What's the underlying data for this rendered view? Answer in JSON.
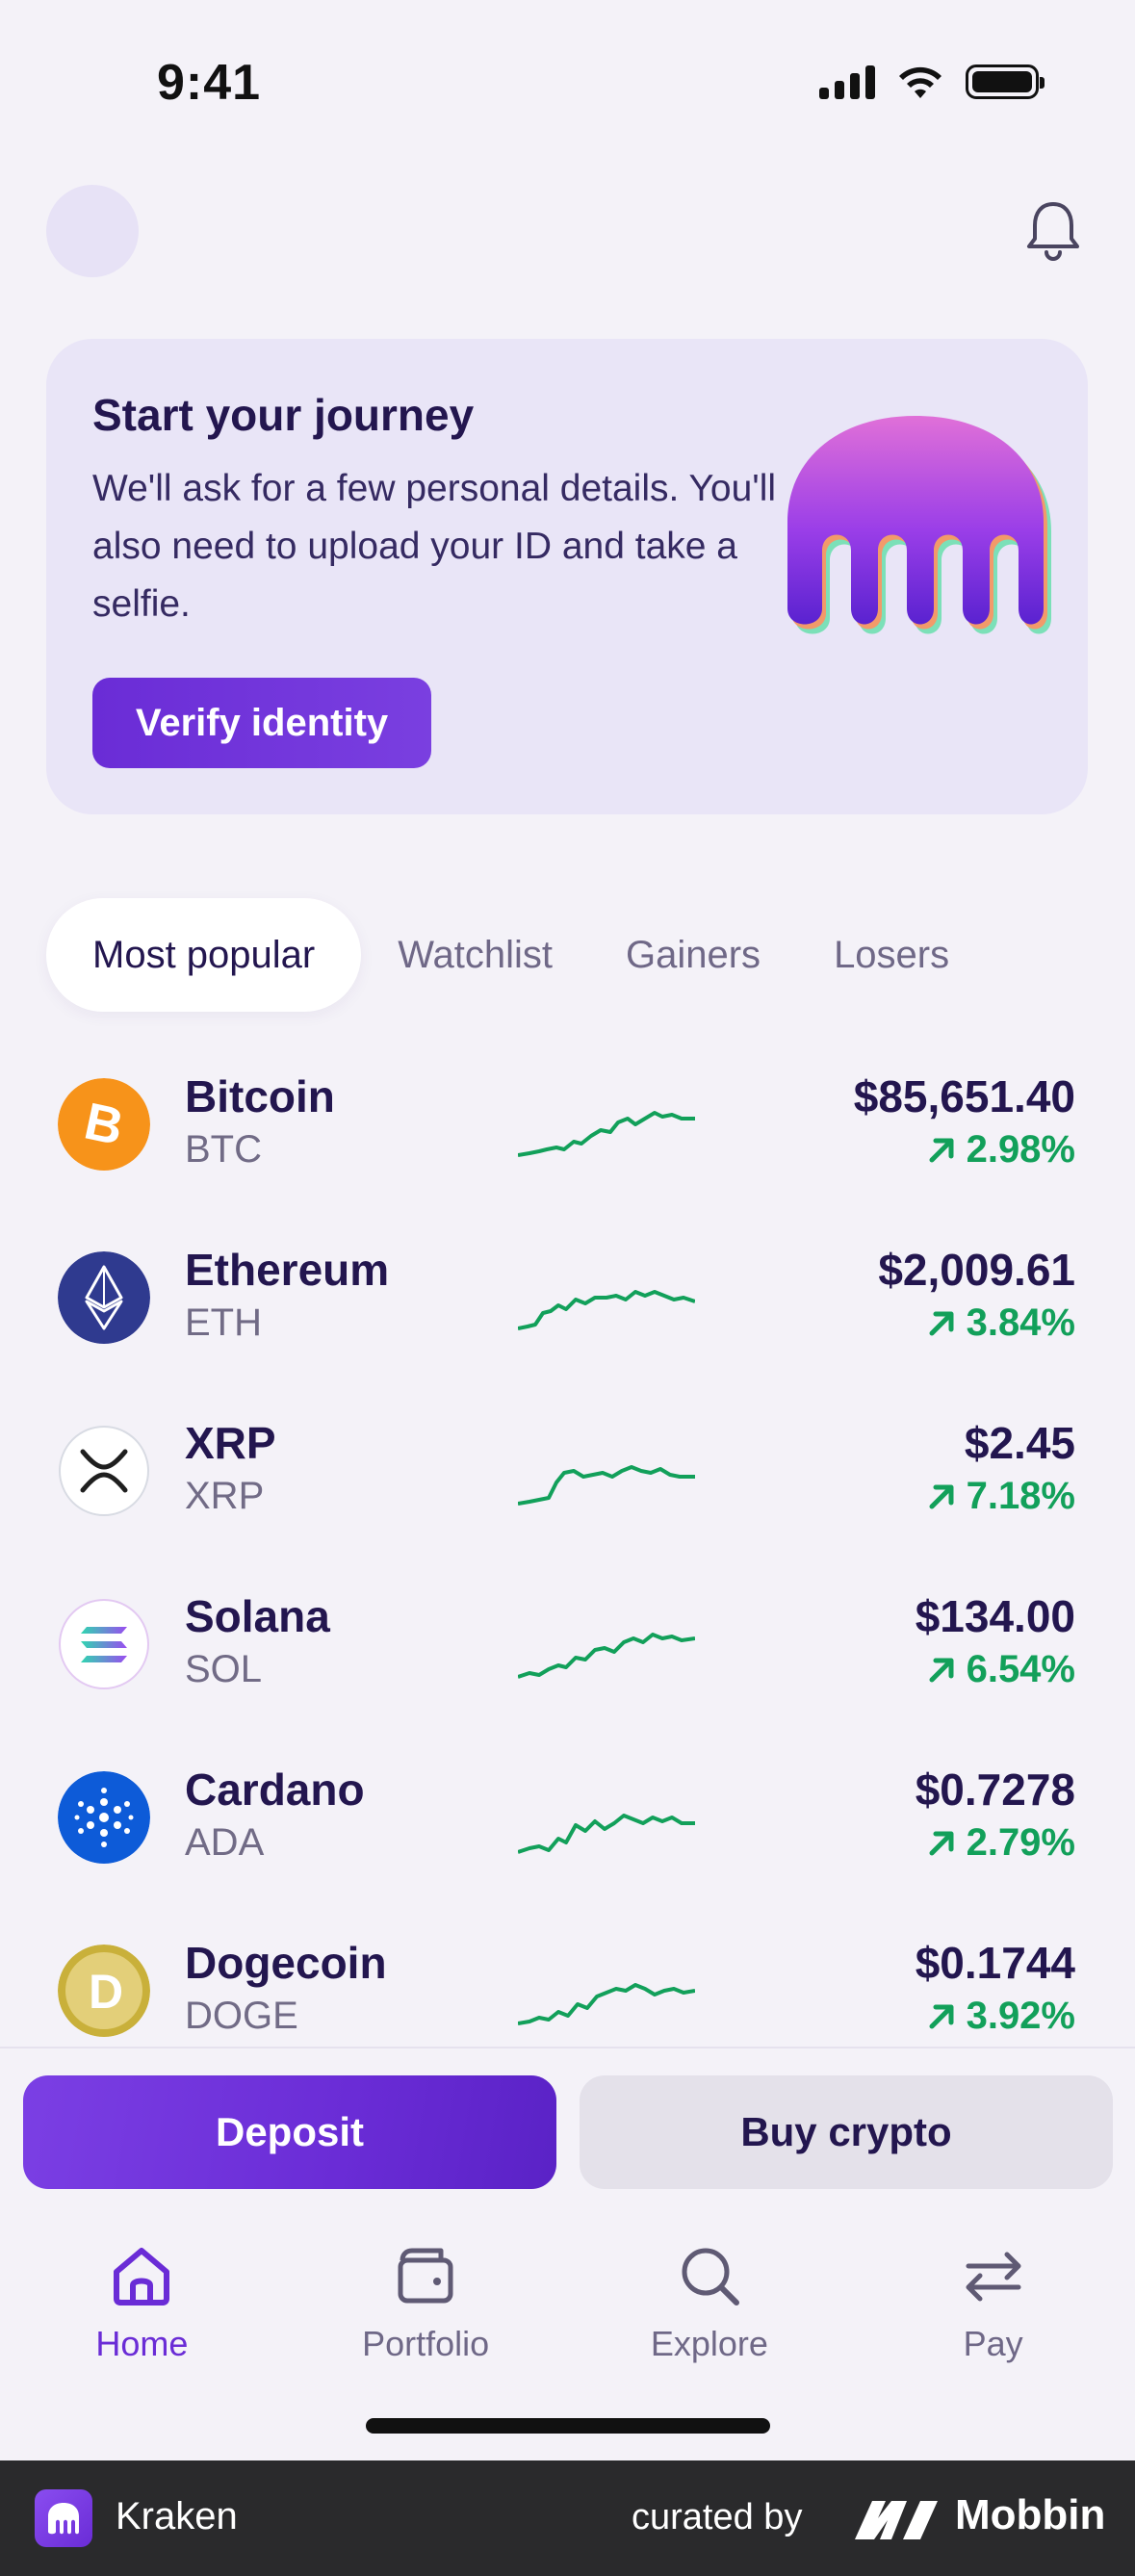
{
  "status": {
    "time": "9:41"
  },
  "journey_card": {
    "title": "Start your journey",
    "body": "We'll ask for a few personal details. You'll also need to upload your ID and take a selfie.",
    "button_label": "Verify identity"
  },
  "tabs": [
    {
      "label": "Most popular",
      "active": true
    },
    {
      "label": "Watchlist",
      "active": false
    },
    {
      "label": "Gainers",
      "active": false
    },
    {
      "label": "Losers",
      "active": false
    }
  ],
  "assets": [
    {
      "name": "Bitcoin",
      "symbol": "BTC",
      "price": "$85,651.40",
      "change": "2.98%",
      "icon": "bitcoin-icon",
      "color": "#f7931a"
    },
    {
      "name": "Ethereum",
      "symbol": "ETH",
      "price": "$2,009.61",
      "change": "3.84%",
      "icon": "ethereum-icon",
      "color": "#2f3a8f"
    },
    {
      "name": "XRP",
      "symbol": "XRP",
      "price": "$2.45",
      "change": "7.18%",
      "icon": "xrp-icon",
      "color": "#ffffff"
    },
    {
      "name": "Solana",
      "symbol": "SOL",
      "price": "$134.00",
      "change": "6.54%",
      "icon": "solana-icon",
      "color": "#ffffff"
    },
    {
      "name": "Cardano",
      "symbol": "ADA",
      "price": "$0.7278",
      "change": "2.79%",
      "icon": "cardano-icon",
      "color": "#0d5bd8"
    },
    {
      "name": "Dogecoin",
      "symbol": "DOGE",
      "price": "$0.1744",
      "change": "3.92%",
      "icon": "dogecoin-icon",
      "color": "#c9b03a"
    }
  ],
  "actions": {
    "deposit_label": "Deposit",
    "buy_label": "Buy crypto"
  },
  "nav": [
    {
      "label": "Home",
      "icon": "home-icon",
      "active": true
    },
    {
      "label": "Portfolio",
      "icon": "wallet-icon",
      "active": false
    },
    {
      "label": "Explore",
      "icon": "search-icon",
      "active": false
    },
    {
      "label": "Pay",
      "icon": "transfer-arrows-icon",
      "active": false
    }
  ],
  "footer": {
    "app_name": "Kraken",
    "curated_by": "curated by",
    "brand": "Mobbin"
  },
  "colors": {
    "accent": "#6a2cd6",
    "positive": "#12a05a",
    "text_primary": "#23164f",
    "background": "#f4f2f8"
  }
}
